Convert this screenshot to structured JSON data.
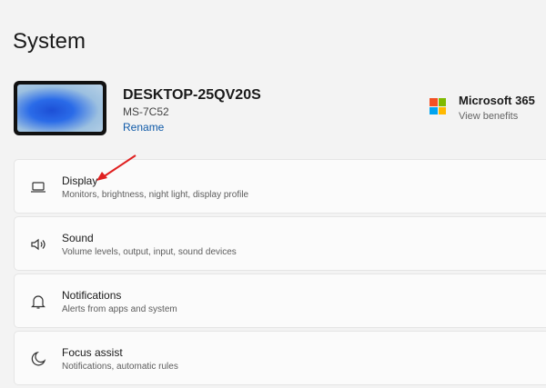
{
  "page": {
    "title": "System"
  },
  "device": {
    "name": "DESKTOP-25QV20S",
    "model": "MS-7C52",
    "rename_label": "Rename"
  },
  "promo": {
    "name": "Microsoft 365",
    "link": "View benefits",
    "logo_colors": [
      "#f25022",
      "#7fba00",
      "#00a4ef",
      "#ffb900"
    ]
  },
  "cards": [
    {
      "title": "Display",
      "subtitle": "Monitors, brightness, night light, display profile",
      "icon": "laptop-icon"
    },
    {
      "title": "Sound",
      "subtitle": "Volume levels, output, input, sound devices",
      "icon": "speaker-icon"
    },
    {
      "title": "Notifications",
      "subtitle": "Alerts from apps and system",
      "icon": "bell-icon"
    },
    {
      "title": "Focus assist",
      "subtitle": "Notifications, automatic rules",
      "icon": "moon-icon"
    }
  ],
  "annotation": {
    "color": "#e02020"
  }
}
